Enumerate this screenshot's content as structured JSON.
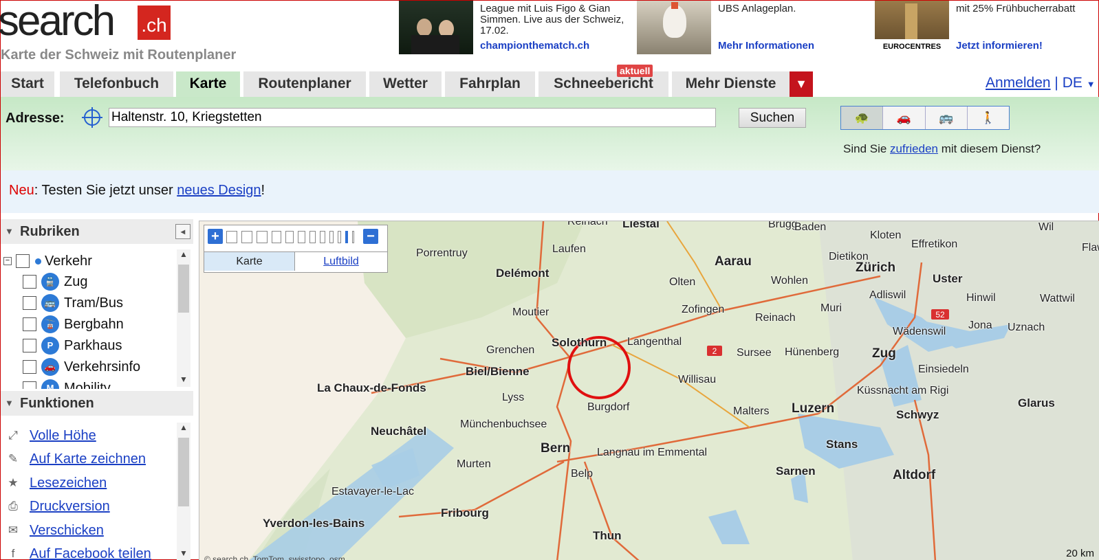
{
  "header": {
    "logo_word": "search",
    "logo_suffix": ".ch",
    "subtitle": "Karte der Schweiz mit Routenplaner"
  },
  "ads": [
    {
      "text": "League mit Luis Figo & Gian Simmen. Live aus der Schweiz, 17.02.",
      "link": "championthematch.ch"
    },
    {
      "text": "UBS Anlageplan.",
      "link": "Mehr Informationen"
    },
    {
      "text": "mit 25% Frühbucherrabatt",
      "link": "Jetzt informieren!",
      "img_label": "EUROCENTRES"
    }
  ],
  "nav": {
    "tabs": [
      "Start",
      "Telefonbuch",
      "Karte",
      "Routenplaner",
      "Wetter",
      "Fahrplan",
      "Schneebericht",
      "Mehr Dienste"
    ],
    "active": "Karte",
    "badge": "aktuell",
    "more_arrow": "▼",
    "login": "Anmelden",
    "separator": "|",
    "language": "DE"
  },
  "search": {
    "label": "Adresse:",
    "value": "Haltenstr. 10, Kriegstetten",
    "button": "Suchen",
    "modes": [
      "🐢",
      "🚗",
      "🚌",
      "🚶"
    ],
    "satisfaction_pre": "Sind Sie ",
    "satisfaction_link": "zufrieden",
    "satisfaction_post": " mit diesem Dienst?"
  },
  "info": {
    "new_label": "Neu",
    "text_pre": ": Testen Sie jetzt unser ",
    "link": "neues Design",
    "text_post": "!"
  },
  "sidebar": {
    "rubriken_title": "Rubriken",
    "collapse": "◂",
    "root_item": "Verkehr",
    "items": [
      {
        "label": "Zug",
        "icon": "train-icon",
        "glyph": "🚆"
      },
      {
        "label": "Tram/Bus",
        "icon": "bus-icon",
        "glyph": "🚌"
      },
      {
        "label": "Bergbahn",
        "icon": "cablecar-icon",
        "glyph": "🚡"
      },
      {
        "label": "Parkhaus",
        "icon": "parking-icon",
        "glyph": "P"
      },
      {
        "label": "Verkehrsinfo",
        "icon": "traffic-info-icon",
        "glyph": "🚗"
      },
      {
        "label": "Mobility",
        "icon": "mobility-icon",
        "glyph": "M"
      }
    ],
    "funktionen_title": "Funktionen",
    "functions": [
      {
        "label": "Volle Höhe",
        "icon": "fullheight-icon",
        "glyph": "⤢"
      },
      {
        "label": "Auf Karte zeichnen",
        "icon": "pencil-icon",
        "glyph": "✎"
      },
      {
        "label": "Lesezeichen",
        "icon": "star-icon",
        "glyph": "★"
      },
      {
        "label": "Druckversion",
        "icon": "printer-icon",
        "glyph": "⎙"
      },
      {
        "label": "Verschicken",
        "icon": "mail-icon",
        "glyph": "✉"
      },
      {
        "label": "Auf Facebook teilen",
        "icon": "facebook-icon",
        "glyph": "f"
      }
    ]
  },
  "map": {
    "zoom_in": "+",
    "zoom_out": "−",
    "tab_map": "Karte",
    "tab_aerial": "Luftbild",
    "scale": "20 km",
    "copyright": "© search.ch, TomTom, swisstopo, osm",
    "road_shields": [
      "2",
      "52"
    ],
    "cities": [
      {
        "name": "Reinach",
        "cls": ""
      },
      {
        "name": "Liestal",
        "cls": "mid"
      },
      {
        "name": "Brugg",
        "cls": ""
      },
      {
        "name": "Baden",
        "cls": ""
      },
      {
        "name": "Wil",
        "cls": ""
      },
      {
        "name": "Kloten",
        "cls": ""
      },
      {
        "name": "Porrentruy",
        "cls": ""
      },
      {
        "name": "Laufen",
        "cls": ""
      },
      {
        "name": "Aarau",
        "cls": "big"
      },
      {
        "name": "Dietikon",
        "cls": ""
      },
      {
        "name": "Effretikon",
        "cls": ""
      },
      {
        "name": "Flaw",
        "cls": ""
      },
      {
        "name": "Delémont",
        "cls": "mid"
      },
      {
        "name": "Olten",
        "cls": ""
      },
      {
        "name": "Zürich",
        "cls": "big"
      },
      {
        "name": "Wohlen",
        "cls": ""
      },
      {
        "name": "Uster",
        "cls": "mid"
      },
      {
        "name": "Adliswil",
        "cls": ""
      },
      {
        "name": "Hinwil",
        "cls": ""
      },
      {
        "name": "Wattwil",
        "cls": ""
      },
      {
        "name": "Moutier",
        "cls": ""
      },
      {
        "name": "Zofingen",
        "cls": ""
      },
      {
        "name": "Muri",
        "cls": ""
      },
      {
        "name": "Reinach",
        "cls": ""
      },
      {
        "name": "Wädenswil",
        "cls": ""
      },
      {
        "name": "Jona",
        "cls": ""
      },
      {
        "name": "Uznach",
        "cls": ""
      },
      {
        "name": "Solothurn",
        "cls": "mid"
      },
      {
        "name": "Langenthal",
        "cls": ""
      },
      {
        "name": "Grenchen",
        "cls": ""
      },
      {
        "name": "Sursee",
        "cls": ""
      },
      {
        "name": "Hünenberg",
        "cls": ""
      },
      {
        "name": "Zug",
        "cls": "big"
      },
      {
        "name": "Biel/Bienne",
        "cls": "mid"
      },
      {
        "name": "Einsiedeln",
        "cls": ""
      },
      {
        "name": "Willisau",
        "cls": ""
      },
      {
        "name": "La Chaux-de-Fonds",
        "cls": "mid"
      },
      {
        "name": "Küssnacht am Rigi",
        "cls": ""
      },
      {
        "name": "Lyss",
        "cls": ""
      },
      {
        "name": "Burgdorf",
        "cls": ""
      },
      {
        "name": "Glarus",
        "cls": "mid"
      },
      {
        "name": "Luzern",
        "cls": "big"
      },
      {
        "name": "Malters",
        "cls": ""
      },
      {
        "name": "Schwyz",
        "cls": "mid"
      },
      {
        "name": "Neuchâtel",
        "cls": "mid"
      },
      {
        "name": "Münchenbuchsee",
        "cls": ""
      },
      {
        "name": "Bern",
        "cls": "big"
      },
      {
        "name": "Stans",
        "cls": "mid"
      },
      {
        "name": "Langnau im Emmental",
        "cls": ""
      },
      {
        "name": "Murten",
        "cls": ""
      },
      {
        "name": "Belp",
        "cls": ""
      },
      {
        "name": "Sarnen",
        "cls": "mid"
      },
      {
        "name": "Altdorf",
        "cls": "big"
      },
      {
        "name": "Estavayer-le-Lac",
        "cls": ""
      },
      {
        "name": "Fribourg",
        "cls": "mid"
      },
      {
        "name": "Yverdon-les-Bains",
        "cls": "mid"
      },
      {
        "name": "Thun",
        "cls": "mid"
      }
    ]
  }
}
